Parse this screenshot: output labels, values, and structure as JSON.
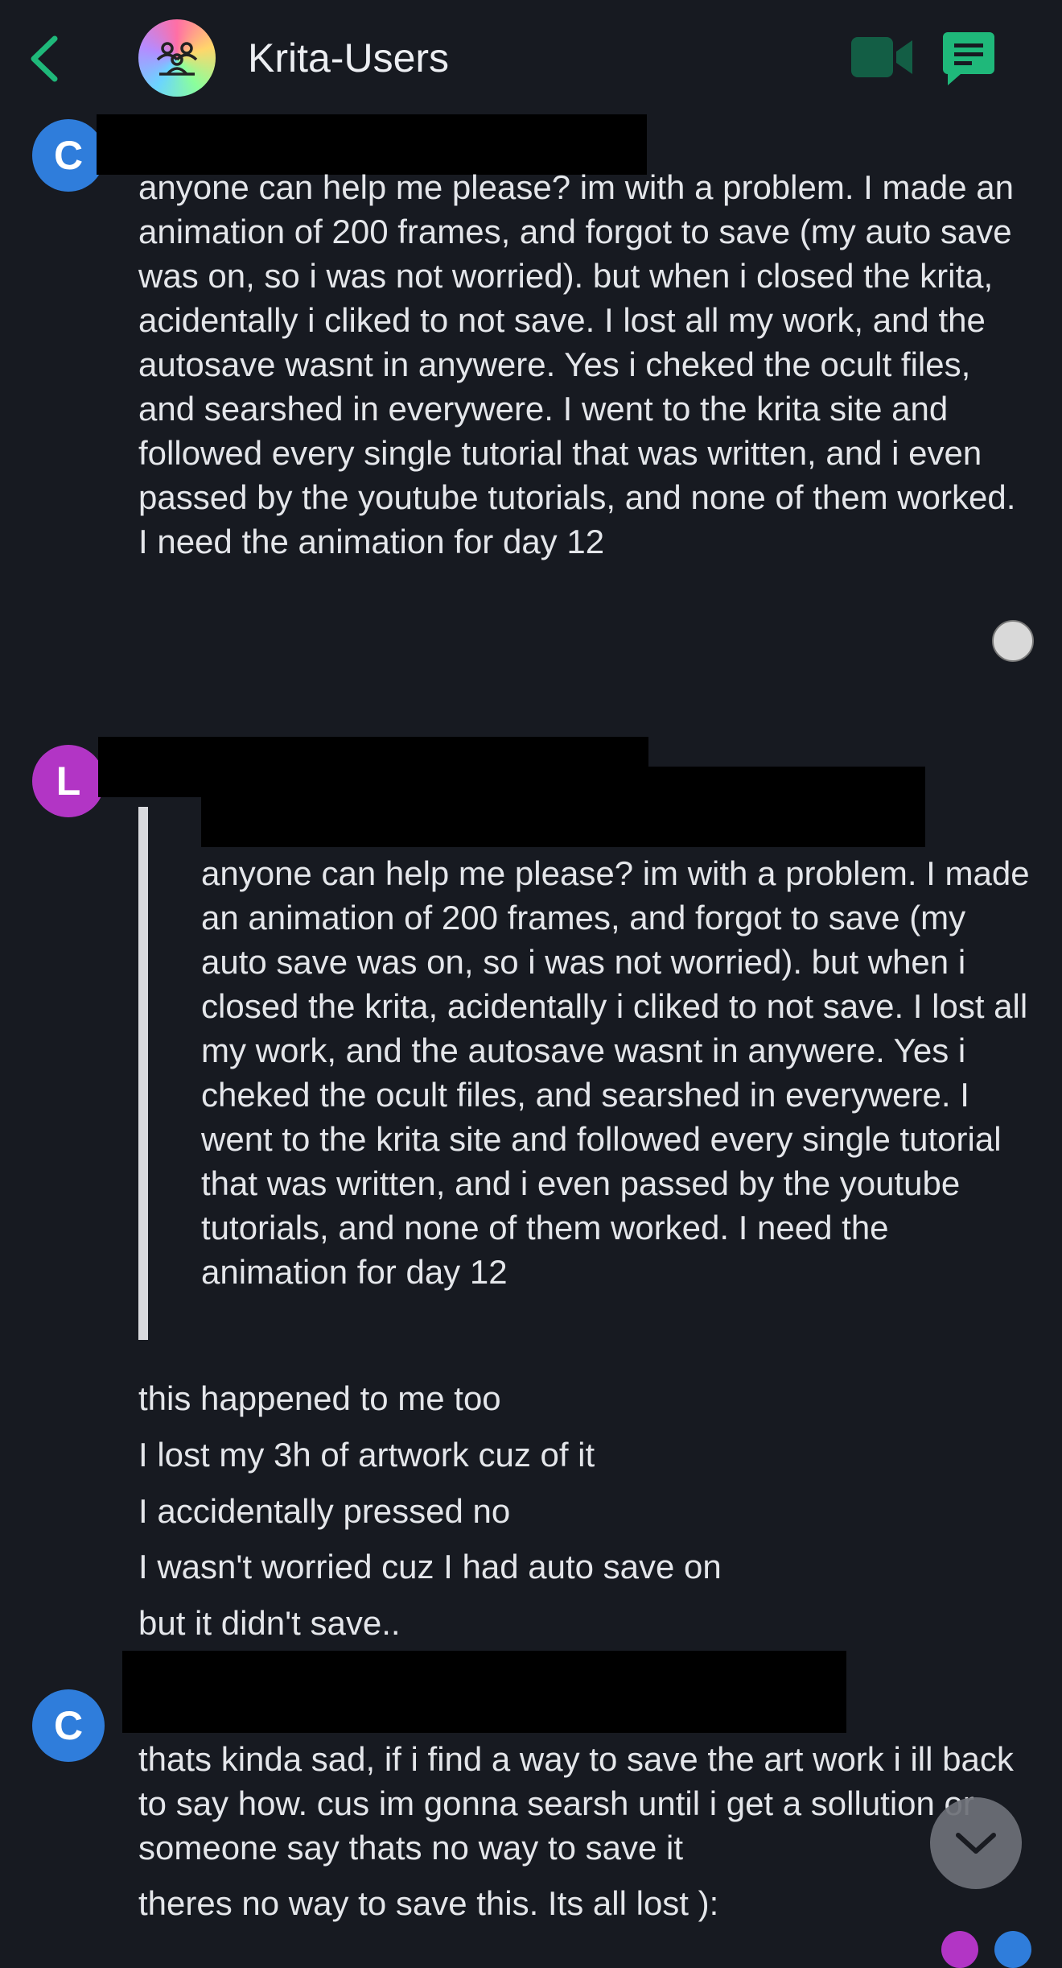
{
  "header": {
    "back_icon": "chevron-left-icon",
    "room_name": "Krita-Users",
    "room_avatar_icon": "group-people-icon",
    "video_call_icon": "video-camera-icon",
    "threads_icon": "chat-bubble-icon",
    "accent": "#1fb87a"
  },
  "messages": [
    {
      "avatar_letter": "C",
      "avatar_color": "#2f7ddb",
      "text": "anyone can help me please? im with a problem. I made an animation of 200 frames, and forgot to save (my auto save was on, so i was not worried). but when i closed the krita, acidentally i cliked to not save. I lost all my work, and the autosave wasnt in anywere. Yes i cheked the ocult files, and searshed in everywere. I went to the krita site and followed every single tutorial that was written, and i even passed by the youtube tutorials, and none of them worked. I need the animation for day 12"
    },
    {
      "avatar_letter": "L",
      "avatar_color": "#b235c5",
      "quote_text": "anyone can help me please? im with a problem. I made an animation of 200 frames, and forgot to save (my auto save was on, so i was not worried). but when i closed the krita, acidentally i cliked to not save. I lost all my work, and the autosave wasnt in anywere. Yes i cheked the ocult files, and searshed in everywere. I went to the krita site and followed every single tutorial that was written, and i even passed by the youtube tutorials, and none of them worked. I need the animation for day 12",
      "replies": [
        "this happened to me too",
        "I lost my 3h of artwork cuz of it",
        "I accidentally pressed no",
        "I wasn't worried cuz I had auto save on",
        "but it didn't save.."
      ]
    },
    {
      "avatar_letter": "C",
      "avatar_color": "#2f7ddb",
      "text": "thats kinda sad, if i find a way to save the art work i ill back to say how. cus im gonna searsh until i get a sollution or someone say thats no way to save it",
      "text2": "theres no way to save this. Its all lost ):"
    }
  ],
  "scroll_down_icon": "chevron-down-icon"
}
